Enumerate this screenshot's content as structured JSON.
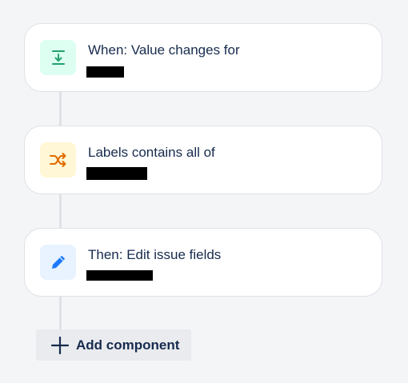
{
  "steps": [
    {
      "title": "When: Value changes for",
      "icon": "download-arrow-icon",
      "icon_color": "#22a06b",
      "icon_bg": "#dcfff1"
    },
    {
      "title": "Labels contains all of",
      "icon": "shuffle-icon",
      "icon_color": "#e06c00",
      "icon_bg": "#fff7d6"
    },
    {
      "title": "Then: Edit issue fields",
      "icon": "pencil-icon",
      "icon_color": "#1d7afc",
      "icon_bg": "#e9f2ff"
    }
  ],
  "add_component": {
    "label": "Add component",
    "icon": "plus-icon"
  },
  "colors": {
    "background": "#f4f5f7",
    "card_border": "#dfe1e6",
    "connector": "#dfe1e6",
    "text": "#172b4d",
    "button_bg": "#e9ebee"
  }
}
